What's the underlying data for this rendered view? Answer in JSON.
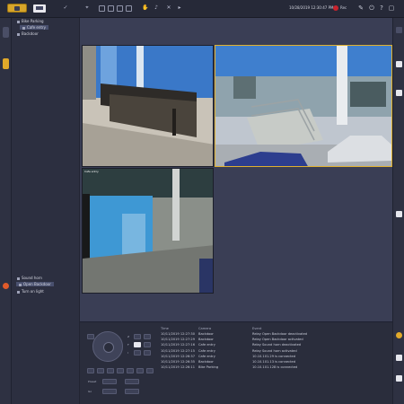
{
  "toolbar": {
    "datetime": "10/28/2019 12:30:47 PM",
    "rec_label": "Rec",
    "icons": [
      "logo-icon",
      "tab-icon",
      "check-icon",
      "cut-icon",
      "layout-1-icon",
      "layout-4-icon",
      "layout-9-icon",
      "layout-16-icon",
      "hand-icon",
      "audio-icon",
      "ptz-icon",
      "next-icon",
      "record-icon",
      "edit-icon",
      "power-icon",
      "help-icon",
      "window-icon"
    ]
  },
  "sidebar": {
    "cameras": [
      {
        "label": "Bike Parking"
      },
      {
        "label": "Cafe entry"
      },
      {
        "label": "Backdoor"
      }
    ],
    "actions": [
      {
        "label": "Sound horn"
      },
      {
        "label": "Open Backdoor"
      },
      {
        "label": "Turn on light"
      }
    ]
  },
  "video": {
    "tiles": [
      {
        "name": "tile-1",
        "label": "",
        "active": false
      },
      {
        "name": "tile-2",
        "label": "",
        "active": true
      },
      {
        "name": "tile-3",
        "label": "Cafe entry",
        "active": false
      },
      {
        "name": "tile-4",
        "label": "",
        "active": false
      }
    ]
  },
  "events": {
    "headers": [
      "Time",
      "Camera",
      "Event"
    ],
    "rows": [
      {
        "time": "10/11/2019 12:27:30",
        "camera": "Backdoor",
        "event": "Relay Open Backdoor deactivated"
      },
      {
        "time": "10/11/2019 12:27:29",
        "camera": "Backdoor",
        "event": "Relay Open Backdoor activated"
      },
      {
        "time": "10/11/2019 12:27:16",
        "camera": "Cafe entry",
        "event": "Relay Sound horn deactivated"
      },
      {
        "time": "10/11/2019 12:27:15",
        "camera": "Cafe entry",
        "event": "Relay Sound horn activated"
      },
      {
        "time": "10/11/2019 12:26:37",
        "camera": "Cafe entry",
        "event": "10.10.101.29 is connected"
      },
      {
        "time": "10/11/2019 12:26:35",
        "camera": "Backdoor",
        "event": "10.10.101.13 is connected"
      },
      {
        "time": "10/11/2019 12:26:11",
        "camera": "Bike Parking",
        "event": "10.10.101.128 is connected"
      }
    ]
  },
  "ptz": {
    "labels": [
      "Z",
      "F",
      "I",
      "Preset",
      "Go"
    ]
  }
}
